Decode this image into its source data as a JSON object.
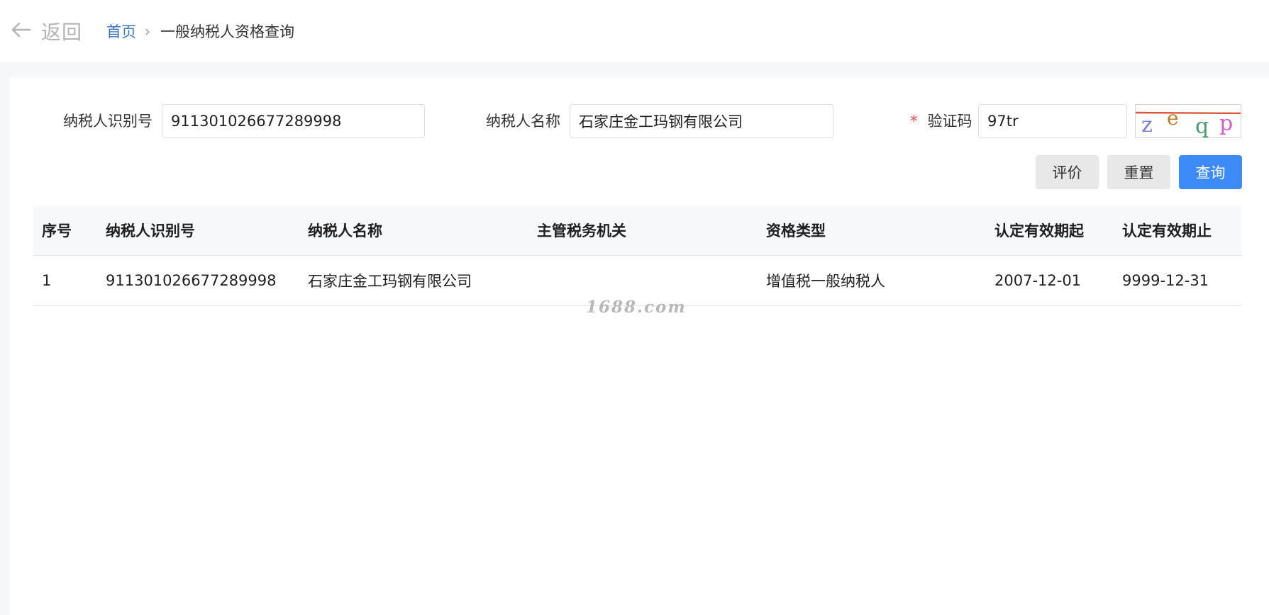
{
  "header": {
    "back_label": "返回",
    "breadcrumb": {
      "home": "首页",
      "separator": "›",
      "current": "一般纳税人资格查询"
    }
  },
  "form": {
    "taxpayer_id_label": "纳税人识别号",
    "taxpayer_id_value": "911301026677289998",
    "taxpayer_name_label": "纳税人名称",
    "taxpayer_name_value": "石家庄金工玛钢有限公司",
    "captcha_required_mark": "*",
    "captcha_label": "验证码",
    "captcha_value": "97tr",
    "captcha_image_chars": [
      "z",
      "e",
      "q",
      "p"
    ]
  },
  "buttons": {
    "evaluate": "评价",
    "reset": "重置",
    "query": "查询"
  },
  "table": {
    "columns": [
      "序号",
      "纳税人识别号",
      "纳税人名称",
      "主管税务机关",
      "资格类型",
      "认定有效期起",
      "认定有效期止"
    ],
    "rows": [
      [
        "1",
        "911301026677289998",
        "石家庄金工玛钢有限公司",
        "",
        "增值税一般纳税人",
        "2007-12-01",
        "9999-12-31"
      ]
    ]
  },
  "watermark": "1688.com",
  "colors": {
    "accent": "#3d8bf7",
    "link": "#3f74b6",
    "required": "#e04a3f",
    "header_bg": "#f7f8fa"
  }
}
